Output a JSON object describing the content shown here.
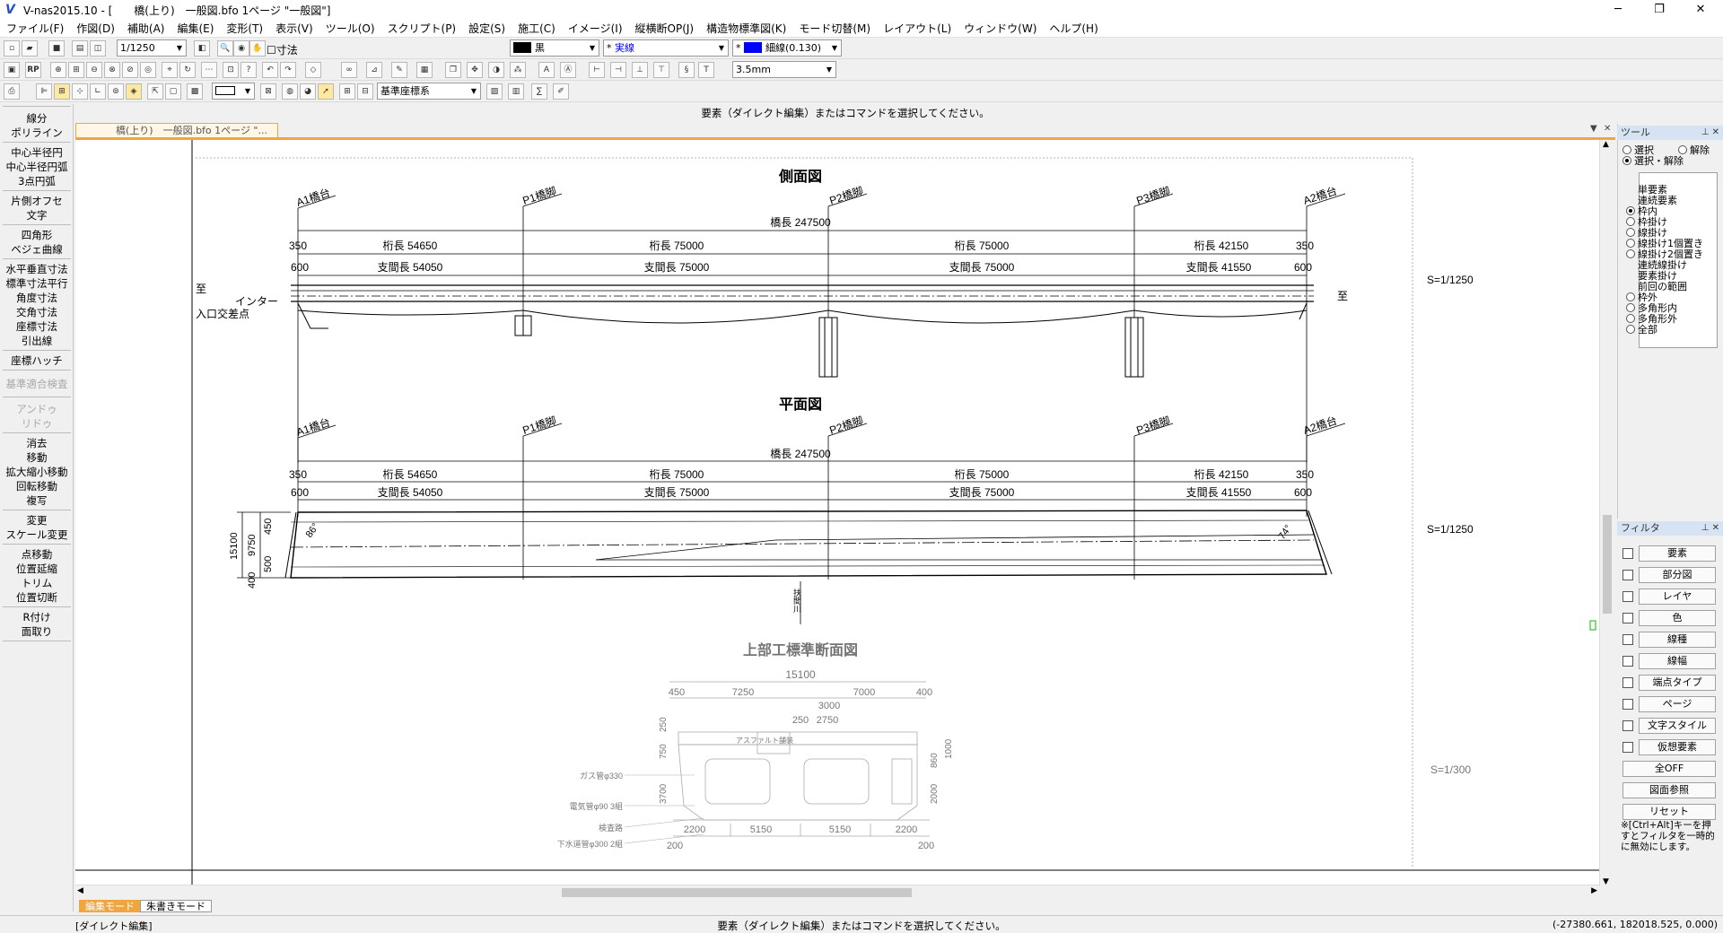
{
  "window": {
    "title": "V-nas2015.10 - [　　橋(上り)　一般図.bfo 1ページ \"一般図\"]",
    "btn_min": "─",
    "btn_max": "❐",
    "btn_close": "✕"
  },
  "menu": [
    "ファイル(F)",
    "作図(D)",
    "補助(A)",
    "編集(E)",
    "変形(T)",
    "表示(V)",
    "ツール(O)",
    "スクリプト(P)",
    "設定(S)",
    "施工(C)",
    "イメージ(I)",
    "縦横断OP(J)",
    "構造物標準図(K)",
    "モード切替(M)",
    "レイアウト(L)",
    "ウィンドウ(W)",
    "ヘルプ(H)"
  ],
  "toolbar": {
    "scale": "1/1250",
    "dim_label": "寸法",
    "color": "黒",
    "color_hex": "#000000",
    "line_type": "実線",
    "line_width": "細線(0.130)",
    "line_color_hex": "#0000ff",
    "text_size": "3.5mm",
    "coord_system": "基準座標系",
    "star": "*"
  },
  "left_buttons": {
    "g1": [
      "線分",
      "ポリライン"
    ],
    "g2": [
      "中心半径円",
      "中心半径円弧",
      "3点円弧"
    ],
    "g3": [
      "片側オフセ",
      "文字"
    ],
    "g4": [
      "四角形",
      "ベジェ曲線"
    ],
    "g5": [
      "水平垂直寸法",
      "標準寸法平行",
      "角度寸法",
      "交角寸法",
      "座標寸法",
      "引出線"
    ],
    "g6": [
      "座標ハッチ"
    ],
    "g7": [
      "基準適合検査"
    ],
    "g8": [
      "アンドゥ",
      "リドゥ"
    ],
    "g9": [
      "消去",
      "移動",
      "拡大縮小移動",
      "回転移動",
      "複写"
    ],
    "g10": [
      "変更",
      "スケール変更"
    ],
    "g11": [
      "点移動",
      "位置延縮",
      "トリム",
      "位置切断"
    ],
    "g12": [
      "R付け",
      "面取り"
    ]
  },
  "command_prompt": "要素（ダイレクト編集）またはコマンドを選択してください。",
  "doc_tab": "橋(上り)　一般図.bfo 1ページ \"...",
  "tool_panel": {
    "title": "ツール",
    "select": "選択",
    "release": "解除",
    "select_release": "選択・解除",
    "items": [
      "単要素",
      "連続要素",
      "枠内",
      "枠掛け",
      "線掛け",
      "線掛け1個置き",
      "線掛け2個置き",
      "連続線掛け",
      "要素掛け",
      "前回の範囲",
      "枠外",
      "多角形内",
      "多角形外",
      "全部"
    ],
    "radio_state": [
      null,
      null,
      true,
      false,
      false,
      false,
      false,
      null,
      null,
      null,
      false,
      false,
      false,
      false
    ]
  },
  "filter_panel": {
    "title": "フィルタ",
    "items": [
      "要素",
      "部分図",
      "レイヤ",
      "色",
      "線種",
      "線幅",
      "端点タイプ",
      "ページ",
      "文字スタイル",
      "仮想要素"
    ],
    "buttons": [
      "全OFF",
      "図面参照",
      "リセット"
    ],
    "note": "※[Ctrl+Alt]キーを押すとフィルタを一時的に無効にします。"
  },
  "modes": [
    "編集モード",
    "朱書きモード"
  ],
  "status": {
    "left": "[ダイレクト編集]",
    "center": "要素（ダイレクト編集）またはコマンドを選択してください。",
    "coords": "(-27380.661, 182018.525, 0.000)"
  },
  "drawing": {
    "side_title": "側面図",
    "plan_title": "平面図",
    "section_title": "上部工標準断面図",
    "supports": [
      "A1橋台",
      "P1橋脚",
      "P2橋脚",
      "P3橋脚",
      "A2橋台"
    ],
    "bridge_length": "橋長 247500",
    "girder": [
      "桁長 54650",
      "桁長 75000",
      "桁長 75000",
      "桁長 42150"
    ],
    "span": [
      "支間長 54050",
      "支間長 75000",
      "支間長 75000",
      "支間長 41550"
    ],
    "end_350": "350",
    "end_600": "600",
    "to": "至",
    "interchange": "インター",
    "junction": "入口交差点",
    "scale_1": "S=1/1250",
    "scale_2": "S=1/1250",
    "scale_3": "S=1/300",
    "width_dims": [
      "15100",
      "9750",
      "450",
      "500",
      "400"
    ],
    "angle_l": "86°",
    "angle_r": "74°",
    "river": "扶間川",
    "sec_dims_top": [
      "15100",
      "450",
      "7250",
      "7000",
      "400"
    ],
    "sec_dims_mid": [
      "3000",
      "250",
      "2750"
    ],
    "sec_dims_bottom": [
      "2200",
      "5150",
      "5150",
      "2200"
    ],
    "sec_dims_side": [
      "250",
      "750",
      "3700",
      "2000",
      "860",
      "1000",
      "200",
      "200"
    ],
    "asphalt": "アスファルト舗装",
    "sec_labels": [
      "ガス管φ330",
      "電気管φ90 3組",
      "検査路",
      "下水道管φ300 2組"
    ]
  }
}
